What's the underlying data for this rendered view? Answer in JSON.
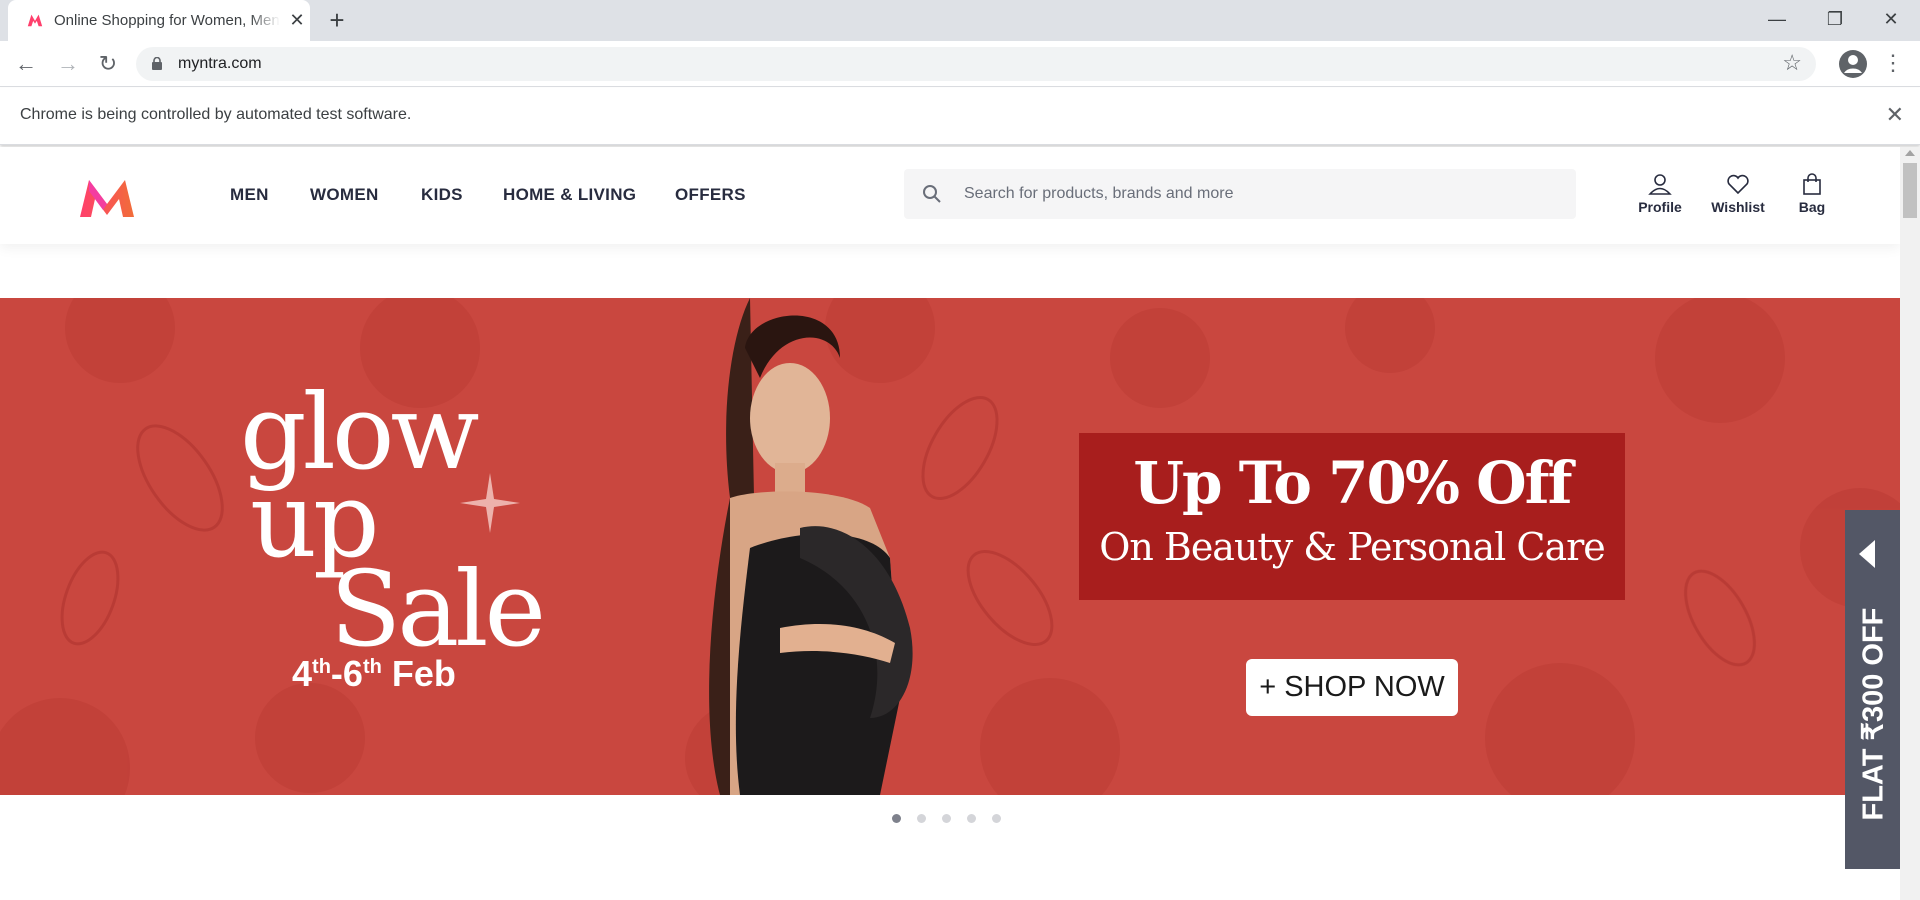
{
  "browser": {
    "tab_title": "Online Shopping for Women, Men, Kids Fashion & Lifestyle - Myntra",
    "new_tab_label": "+",
    "url": "myntra.com",
    "infobar_text": "Chrome is being controlled by automated test software.",
    "icons": [
      "back-icon",
      "forward-icon",
      "reload-icon",
      "lock-icon",
      "star-icon",
      "account-icon",
      "menu-icon",
      "minimize-icon",
      "maximize-icon",
      "close-icon"
    ]
  },
  "site": {
    "nav": [
      "MEN",
      "WOMEN",
      "KIDS",
      "HOME & LIVING",
      "OFFERS"
    ],
    "search_placeholder": "Search for products, brands and more",
    "actions": {
      "profile": "Profile",
      "wishlist": "Wishlist",
      "bag": "Bag"
    },
    "brand_colors": {
      "pink": "#ff3f6c",
      "orange": "#f16d39",
      "banner_red": "#c9473f"
    }
  },
  "banner": {
    "glow_line1": "glow",
    "glow_line2": "up",
    "glow_line3": "Sale",
    "dates_day1": "4",
    "dates_sup1": "th",
    "dates_sep": "-6",
    "dates_sup2": "th",
    "dates_month": " Feb",
    "offer_headline": "Up To 70% Off",
    "offer_sub": "On Beauty & Personal  Care",
    "shop_button": "+ SHOP NOW",
    "carousel_total": 5,
    "carousel_active": 1
  },
  "side_offer": {
    "text": "FLAT ₹300 OFF"
  }
}
